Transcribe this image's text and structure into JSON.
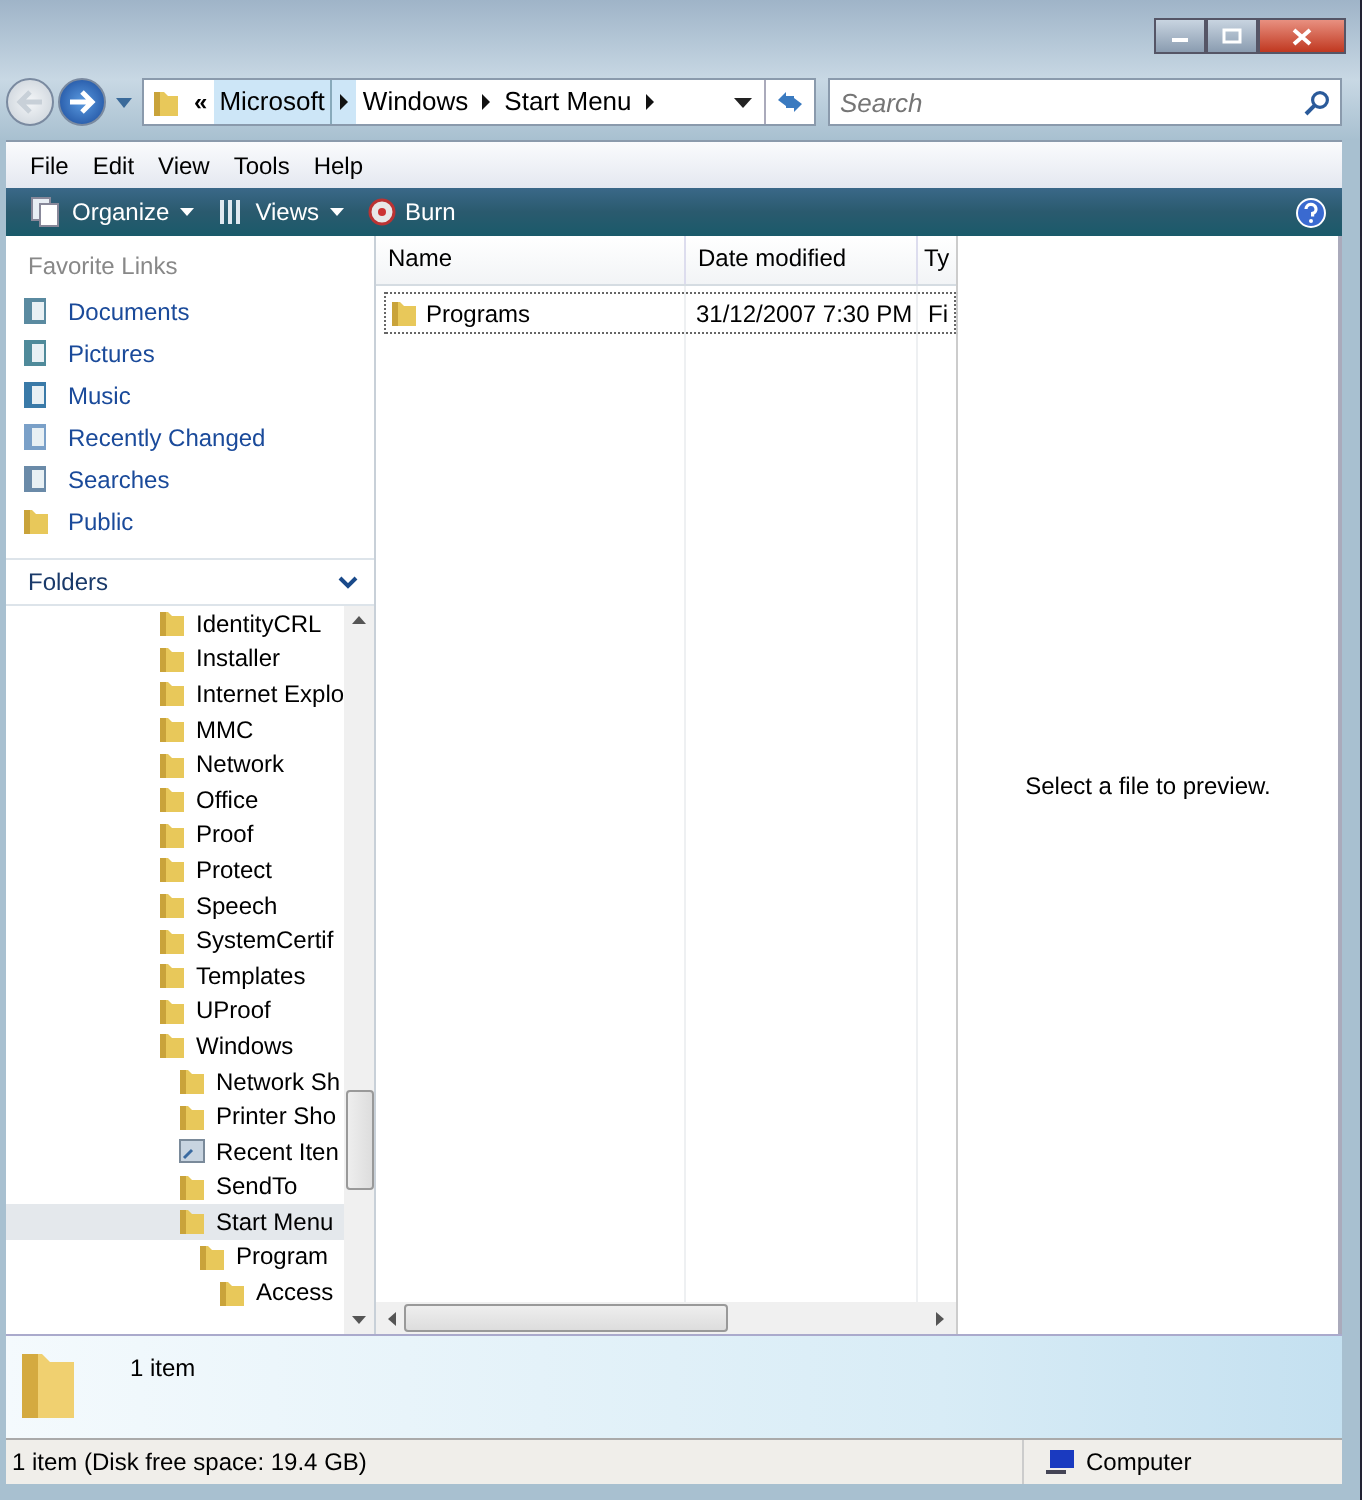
{
  "address_bar": {
    "overflow": "«",
    "crumbs": [
      {
        "label": "Microsoft",
        "selected": true
      },
      {
        "label": "Windows",
        "selected": false
      },
      {
        "label": "Start Menu",
        "selected": false
      }
    ]
  },
  "search": {
    "placeholder": "Search"
  },
  "menu_bar": [
    "File",
    "Edit",
    "View",
    "Tools",
    "Help"
  ],
  "command_bar": [
    {
      "label": "Organize",
      "kind": "organize"
    },
    {
      "label": "Views",
      "kind": "views"
    },
    {
      "label": "Burn",
      "kind": "burn"
    }
  ],
  "favorite_links": {
    "title": "Favorite Links",
    "items": [
      {
        "label": "Documents",
        "kind": "documents"
      },
      {
        "label": "Pictures",
        "kind": "pictures"
      },
      {
        "label": "Music",
        "kind": "music"
      },
      {
        "label": "Recently Changed",
        "kind": "recent"
      },
      {
        "label": "Searches",
        "kind": "searches"
      },
      {
        "label": "Public",
        "kind": "folder"
      }
    ]
  },
  "folders": {
    "title": "Folders",
    "tree": [
      {
        "label": "IdentityCRL",
        "kind": "folder",
        "selected": false
      },
      {
        "label": "Installer",
        "kind": "folder",
        "selected": false
      },
      {
        "label": "Internet Explo",
        "kind": "folder",
        "selected": false
      },
      {
        "label": "MMC",
        "kind": "folder",
        "selected": false
      },
      {
        "label": "Network",
        "kind": "folder",
        "selected": false
      },
      {
        "label": "Office",
        "kind": "folder",
        "selected": false
      },
      {
        "label": "Proof",
        "kind": "folder",
        "selected": false
      },
      {
        "label": "Protect",
        "kind": "folder",
        "selected": false
      },
      {
        "label": "Speech",
        "kind": "folder",
        "selected": false
      },
      {
        "label": "SystemCertif",
        "kind": "folder",
        "selected": false
      },
      {
        "label": "Templates",
        "kind": "folder",
        "selected": false
      },
      {
        "label": "UProof",
        "kind": "folder",
        "selected": false
      },
      {
        "label": "Windows",
        "kind": "folder",
        "selected": false,
        "children": [
          {
            "label": "Network Sh",
            "kind": "folder",
            "selected": false
          },
          {
            "label": "Printer Sho",
            "kind": "folder",
            "selected": false
          },
          {
            "label": "Recent Iten",
            "kind": "shortcut",
            "selected": false
          },
          {
            "label": "SendTo",
            "kind": "folder",
            "selected": false
          },
          {
            "label": "Start Menu",
            "kind": "folder",
            "selected": true,
            "children": [
              {
                "label": "Program",
                "kind": "folder",
                "selected": false,
                "children": [
                  {
                    "label": "Access",
                    "kind": "folder",
                    "selected": false
                  }
                ]
              }
            ]
          }
        ]
      }
    ]
  },
  "file_list": {
    "columns": [
      "Name",
      "Date modified",
      "Ty"
    ],
    "rows": [
      {
        "name": "Programs",
        "date": "31/12/2007 7:30 PM",
        "column_3": "Fi",
        "selected": true
      }
    ]
  },
  "preview": {
    "message": "Select a file to preview."
  },
  "details_pane": {
    "text": "1 item"
  },
  "status_bar": {
    "text": "1 item (Disk free space: 19.4 GB)",
    "zone": "Computer"
  }
}
